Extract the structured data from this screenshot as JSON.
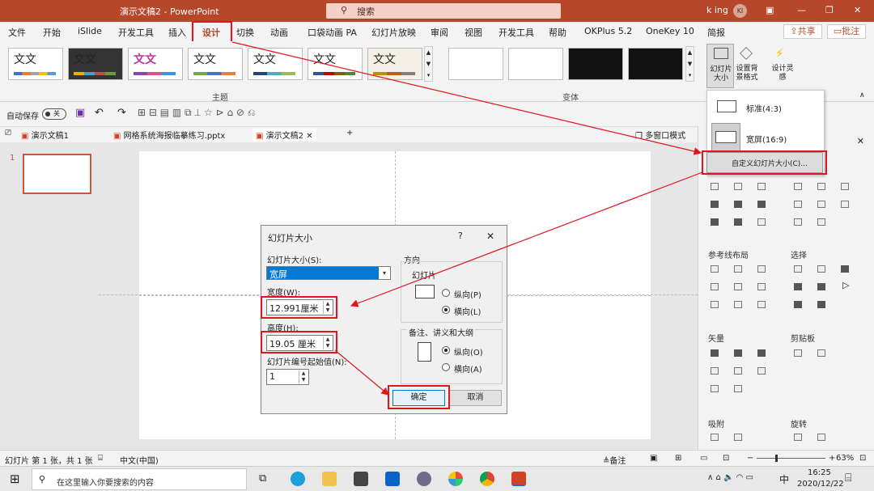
{
  "titlebar": {
    "doc_title": "演示文稿2 - PowerPoint",
    "search_label": "搜索",
    "user": "k ing",
    "avatar_initials": "KI"
  },
  "menu": {
    "items": [
      "文件",
      "开始",
      "iSlide",
      "开发工具",
      "插入",
      "设计",
      "切换",
      "动画",
      "口袋动画 PA",
      "幻灯片放映",
      "审阅",
      "视图",
      "开发工具",
      "帮助",
      "OKPlus 5.2",
      "OneKey 10",
      "简报"
    ],
    "share": "共享",
    "comment": "批注"
  },
  "ribbon": {
    "theme_text": "文文",
    "theme_title": "主题",
    "variant_title": "变体",
    "slide_size_btn": "幻灯片大小",
    "format_bg_btn": "设置背景格式",
    "design_ideas_btn": "设计灵感"
  },
  "qat": {
    "autosave_label": "自动保存",
    "autosave_state": "关"
  },
  "doc_tabs": {
    "tab1": "演示文稿1",
    "tab2": "网格系统海报临摹练习.pptx",
    "tab3": "演示文稿2",
    "multiwindow": "多窗口模式"
  },
  "slide_panel": {
    "slide_number": "1"
  },
  "dropdown": {
    "standard": "标准(4:3)",
    "widescreen": "宽屏(16:9)",
    "custom": "自定义幻灯片大小(C)..."
  },
  "dialog": {
    "title": "幻灯片大小",
    "help": "?",
    "close": "✕",
    "size_label": "幻灯片大小(S):",
    "size_value": "宽屏",
    "width_label": "宽度(W):",
    "width_value": "12.991厘米",
    "height_label": "高度(H):",
    "height_value": "19.05 厘米",
    "start_label": "幻灯片编号起始值(N):",
    "start_value": "1",
    "orientation_label": "方向",
    "slides_group": "幻灯片",
    "portrait": "纵向(P)",
    "landscape": "横向(L)",
    "notes_group": "备注、讲义和大纲",
    "notes_portrait": "纵向(O)",
    "notes_landscape": "横向(A)",
    "ok": "确定",
    "cancel": "取消"
  },
  "right_panel": {
    "guide_layout": "参考线布局",
    "select": "选择",
    "vector": "矢量",
    "clipboard": "剪贴板",
    "snap": "吸附",
    "rotate": "旋转"
  },
  "status": {
    "slide_info": "幻灯片 第 1 张，共 1 张",
    "language": "中文(中国)",
    "notes": "备注",
    "zoom": "63%"
  },
  "taskbar": {
    "search_placeholder": "在这里输入你要搜索的内容",
    "time": "16:25",
    "date": "2020/12/22",
    "ime": "中"
  },
  "colors": {
    "accent": "#b7472a",
    "highlight": "#e0151d",
    "selection": "#0078d7"
  }
}
